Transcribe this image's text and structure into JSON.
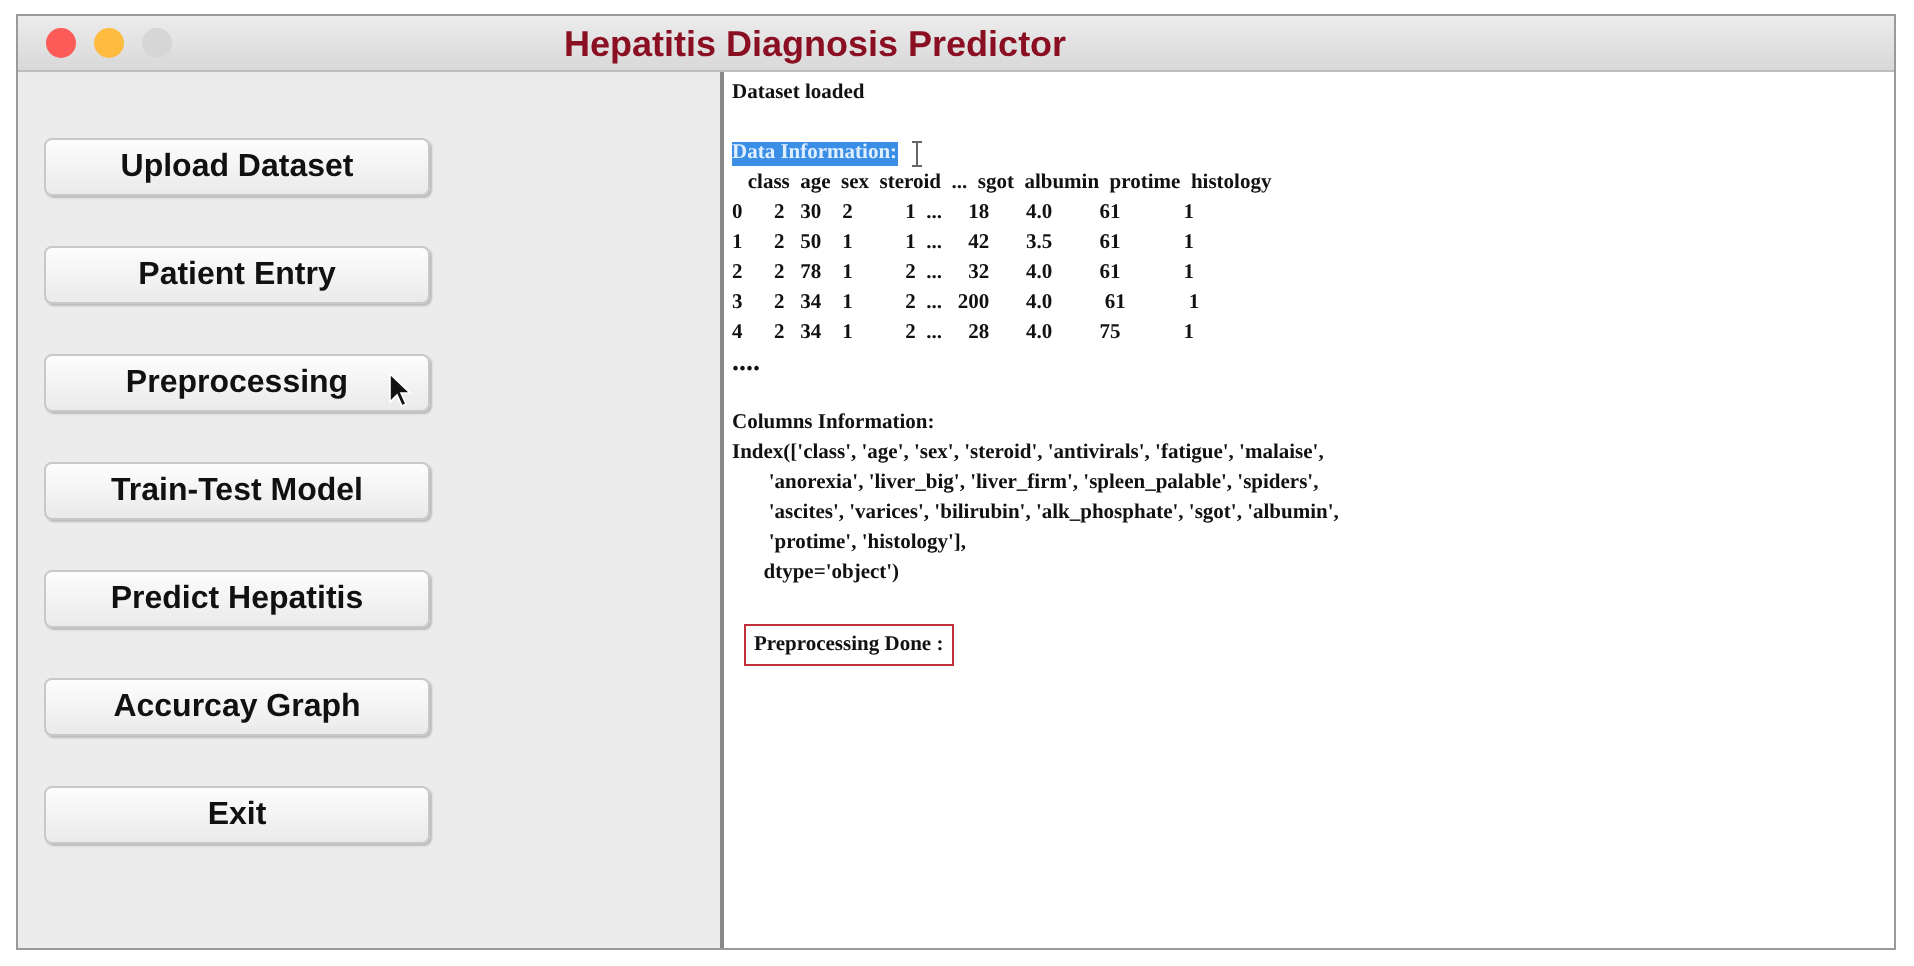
{
  "window": {
    "title": "Hepatitis Diagnosis Predictor",
    "controls": [
      {
        "color": "#fc5b57"
      },
      {
        "color": "#fdbc40"
      },
      {
        "color": "#d6d6d6"
      }
    ]
  },
  "sidebar": {
    "buttons": [
      {
        "label": "Upload Dataset"
      },
      {
        "label": "Patient Entry"
      },
      {
        "label": "Preprocessing"
      },
      {
        "label": "Train-Test Model"
      },
      {
        "label": "Predict Hepatitis"
      },
      {
        "label": "Accurcay Graph"
      },
      {
        "label": "Exit"
      }
    ]
  },
  "output": {
    "lines": [
      {
        "kind": "text",
        "text": "Dataset loaded"
      },
      {
        "kind": "blank"
      },
      {
        "kind": "highlighted",
        "text": "Data Information:"
      },
      {
        "kind": "text",
        "text": "   class  age  sex  steroid  ...  sgot  albumin  protime  histology"
      },
      {
        "kind": "text",
        "text": "0      2   30    2          1  ...     18       4.0         61            1"
      },
      {
        "kind": "text",
        "text": "1      2   50    1          1  ...     42       3.5         61            1"
      },
      {
        "kind": "text",
        "text": "2      2   78    1          2  ...     32       4.0         61            1"
      },
      {
        "kind": "text",
        "text": "3      2   34    1          2  ...   200       4.0          61            1"
      },
      {
        "kind": "text",
        "text": "4      2   34    1          2  ...     28       4.0         75            1"
      },
      {
        "kind": "large",
        "text": "...."
      },
      {
        "kind": "blank"
      },
      {
        "kind": "text",
        "text": "Columns Information:"
      },
      {
        "kind": "text",
        "text": "Index(['class', 'age', 'sex', 'steroid', 'antivirals', 'fatigue', 'malaise',"
      },
      {
        "kind": "text",
        "text": "       'anorexia', 'liver_big', 'liver_firm', 'spleen_palable', 'spiders',"
      },
      {
        "kind": "text",
        "text": "       'ascites', 'varices', 'bilirubin', 'alk_phosphate', 'sgot', 'albumin',"
      },
      {
        "kind": "text",
        "text": "       'protime', 'histology'],"
      },
      {
        "kind": "text",
        "text": "      dtype='object')"
      },
      {
        "kind": "blank"
      },
      {
        "kind": "boxed",
        "text": "Preprocessing Done :"
      }
    ]
  }
}
